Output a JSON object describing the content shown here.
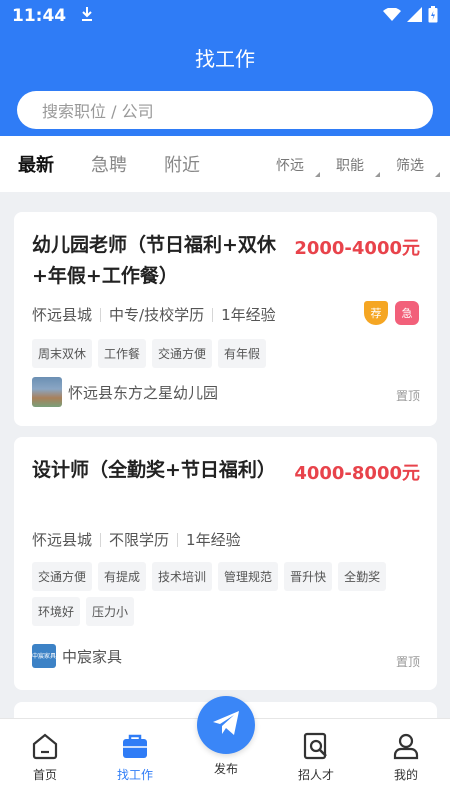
{
  "status_bar": {
    "time": "11:44"
  },
  "header": {
    "title": "找工作"
  },
  "search": {
    "placeholder": "搜索职位 / 公司"
  },
  "filter": {
    "tabs": [
      "最新",
      "急聘",
      "附近"
    ],
    "options": [
      "怀远",
      "职能",
      "筛选"
    ]
  },
  "jobs": [
    {
      "title": "幼儿园老师（节日福利+双休+年假+工作餐）",
      "salary": "2000-4000元",
      "location": "怀远县城",
      "education": "中专/技校学历",
      "experience": "1年经验",
      "tags": [
        "周末双休",
        "工作餐",
        "交通方便",
        "有年假"
      ],
      "company": "怀远县东方之星幼儿园",
      "pin": "置顶",
      "badges": [
        "荐",
        "急"
      ]
    },
    {
      "title": "设计师（全勤奖+节日福利）",
      "salary": "4000-8000元",
      "location": "怀远县城",
      "education": "不限学历",
      "experience": "1年经验",
      "tags": [
        "交通方便",
        "有提成",
        "技术培训",
        "管理规范",
        "晋升快",
        "全勤奖",
        "环境好",
        "压力小"
      ],
      "company": "中宸家具",
      "company_logo_text": "中宸家具",
      "pin": "置顶"
    }
  ],
  "tabbar": {
    "items": [
      {
        "label": "首页",
        "icon": "home-icon"
      },
      {
        "label": "找工作",
        "icon": "briefcase-icon",
        "active": true
      },
      {
        "label": "发布",
        "icon": "send-icon"
      },
      {
        "label": "招人才",
        "icon": "resume-search-icon"
      },
      {
        "label": "我的",
        "icon": "user-icon"
      }
    ]
  },
  "colors": {
    "primary": "#2f7cf6",
    "salary": "#e8434b",
    "recommend_badge": "#f5a623",
    "urgent_badge": "#f2607a"
  }
}
